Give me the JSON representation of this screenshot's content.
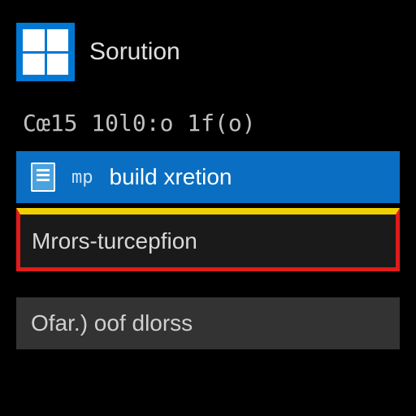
{
  "header": {
    "title": "Sorution"
  },
  "code_line": "Cœ15 10l0:o 1f(o)",
  "build_row": {
    "tag": "mp",
    "label": "build xretion"
  },
  "error_row": {
    "label": "Mrors-turcepfion"
  },
  "status_row": {
    "label": "Ofar.) oof dlorss"
  },
  "colors": {
    "accent": "#0078d4",
    "error": "#e01b1b",
    "warn": "#f0d000",
    "panel": "#333333"
  }
}
